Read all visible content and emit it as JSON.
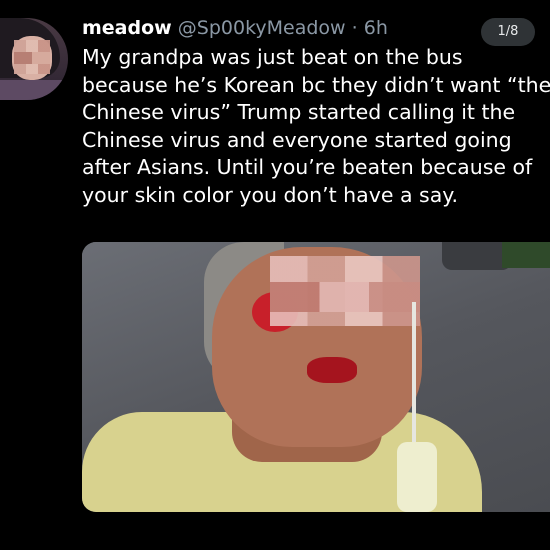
{
  "tweet": {
    "display_name": "meadow",
    "handle": "@Sp00kyMeadow",
    "separator": "·",
    "time": "6h",
    "counter": "1/8",
    "text_lines": [
      "My grandpa was just beat on the bus",
      "because he’s Korean bc they didn’t want “the",
      "Chinese virus” Trump started calling it the",
      "Chinese virus and everyone started going",
      "after Asians. Until you’re beaten because of",
      "your skin color you don’t have a say."
    ]
  },
  "colors": {
    "background": "#000000",
    "text": "#ffffff",
    "handle": "#8b98a5",
    "counter_bg": "#2f3336"
  }
}
